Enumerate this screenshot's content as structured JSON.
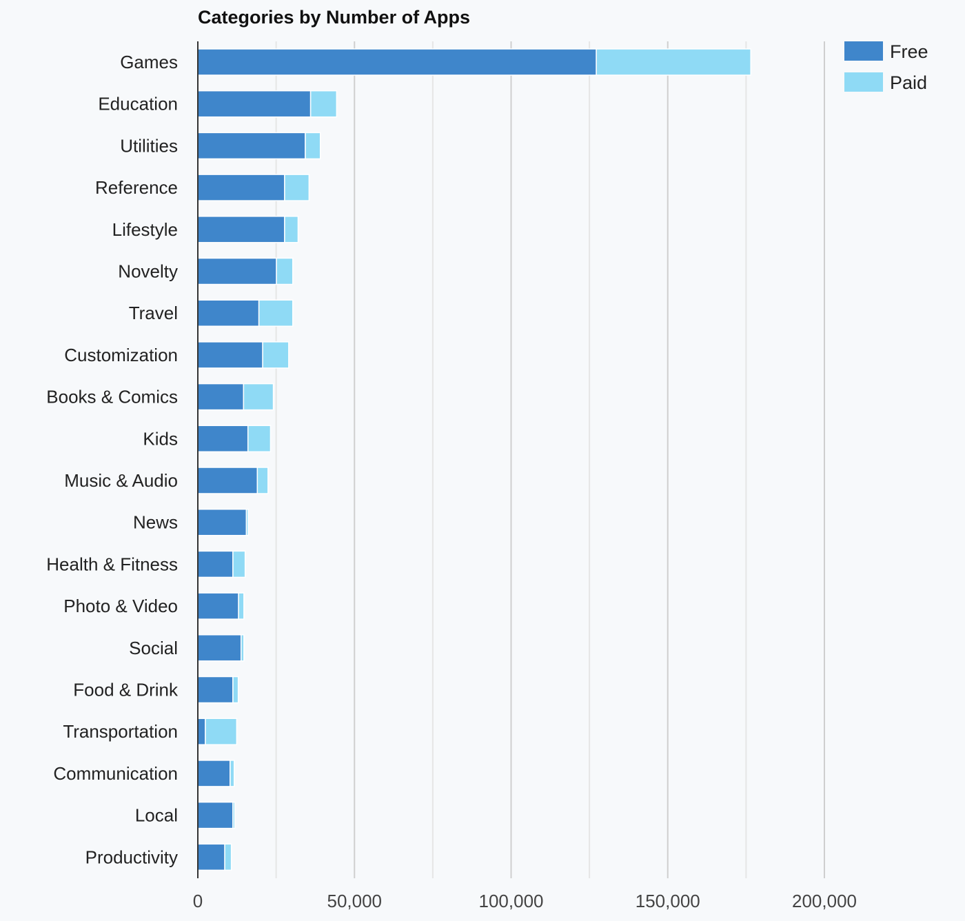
{
  "chart_data": {
    "type": "bar",
    "orientation": "horizontal",
    "stacked": true,
    "title": "Categories by Number of Apps",
    "xlabel": "",
    "ylabel": "",
    "xlim": [
      0,
      200000
    ],
    "xticks": [
      0,
      50000,
      100000,
      150000,
      200000
    ],
    "xtick_labels": [
      "0",
      "50,000",
      "100,000",
      "150,000",
      "200,000"
    ],
    "minor_grid_step": 25000,
    "grid": true,
    "legend_position": "top-right",
    "categories": [
      "Games",
      "Education",
      "Utilities",
      "Reference",
      "Lifestyle",
      "Novelty",
      "Travel",
      "Customization",
      "Books & Comics",
      "Kids",
      "Music & Audio",
      "News",
      "Health & Fitness",
      "Photo & Video",
      "Social",
      "Food & Drink",
      "Transportation",
      "Communication",
      "Local",
      "Productivity"
    ],
    "series": [
      {
        "name": "Free",
        "color": "#3f86cb",
        "values": [
          127200,
          36000,
          34300,
          27700,
          27700,
          25100,
          19500,
          20700,
          14600,
          16000,
          19000,
          15500,
          11200,
          13000,
          13800,
          11200,
          2400,
          10300,
          11200,
          8600
        ]
      },
      {
        "name": "Paid",
        "color": "#8fdaf5",
        "values": [
          49300,
          8300,
          4800,
          7800,
          4300,
          5200,
          10800,
          8300,
          9500,
          7200,
          3400,
          600,
          3900,
          1700,
          900,
          1700,
          10000,
          1300,
          600,
          2100
        ]
      }
    ]
  }
}
